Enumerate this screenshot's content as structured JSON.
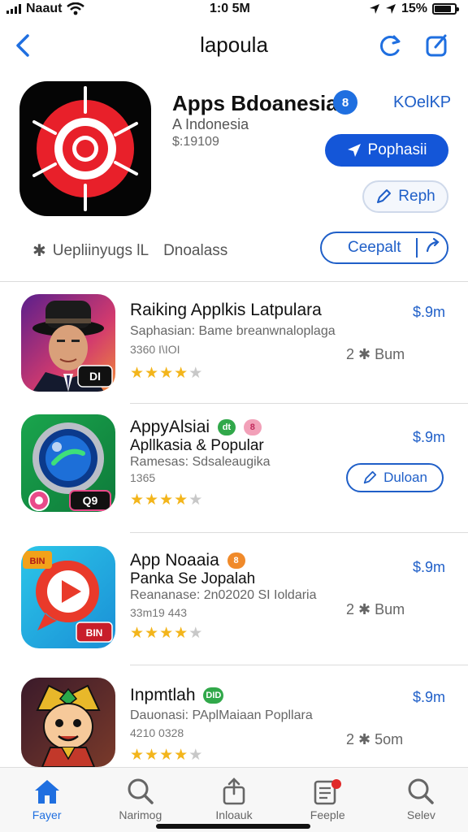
{
  "status_bar": {
    "carrier": "Naaut",
    "time": "1:0 5M",
    "battery": "15%",
    "battery_level": 0.85
  },
  "nav": {
    "title": "lapoula"
  },
  "header": {
    "app_name": "Apps Bdoanesia",
    "verify_badge": "8",
    "code": "KOelKP",
    "subtitle": "A Indonesia",
    "price": "$:19109",
    "primary_button": "Pophasii",
    "reply_button": "Reph",
    "meta_text": "Uepliinyugs  lL",
    "meta_text2": "Dnoalass",
    "get_button": "Ceepalt"
  },
  "apps": [
    {
      "title": "Raiking Applkis Latpulara",
      "desc": "Saphasian: Bame breanwnaloplaga",
      "code": "3360 I\\IOI",
      "rating": 4,
      "price": "$.9m",
      "meta": "2 ✱ Bum",
      "icon_label": "DI"
    },
    {
      "title": "AppyAlsiai",
      "title2": "Apllkasia & Popular",
      "desc": "Ramesas: Sdsaleaugika",
      "code": "1365",
      "rating": 4,
      "price": "$.9m",
      "button": "Duloan",
      "badge1": "dt",
      "badge2": "8",
      "icon_label": "Q9"
    },
    {
      "title": "App Noaaia",
      "title2": "Panka Se Jopalah",
      "desc": "Reananase: 2n02020 SI Ioldaria",
      "code": "33m19 443",
      "rating": 4,
      "price": "$.9m",
      "meta": "2 ✱ Bum",
      "badge1": "8",
      "icon_corner": "BIN",
      "icon_label": "BIN"
    },
    {
      "title": "Inpmtlah",
      "desc": "Dauonasi: PAplMaiaan Popllara",
      "code": "4210 0328",
      "rating": 4,
      "price": "$.9m",
      "meta": "2 ✱ 5om",
      "badge1": "DID"
    }
  ],
  "tabs": [
    {
      "label": "Fayer",
      "icon": "home-icon",
      "active": true
    },
    {
      "label": "Narimog",
      "icon": "search-icon",
      "active": false
    },
    {
      "label": "Inloauk",
      "icon": "share-icon",
      "active": false
    },
    {
      "label": "Feeple",
      "icon": "news-icon",
      "active": false
    },
    {
      "label": "Selev",
      "icon": "search-icon",
      "active": false
    }
  ],
  "colors": {
    "accent": "#1f6fe0",
    "star": "#f3b51b",
    "primary_button": "#1456d8"
  }
}
